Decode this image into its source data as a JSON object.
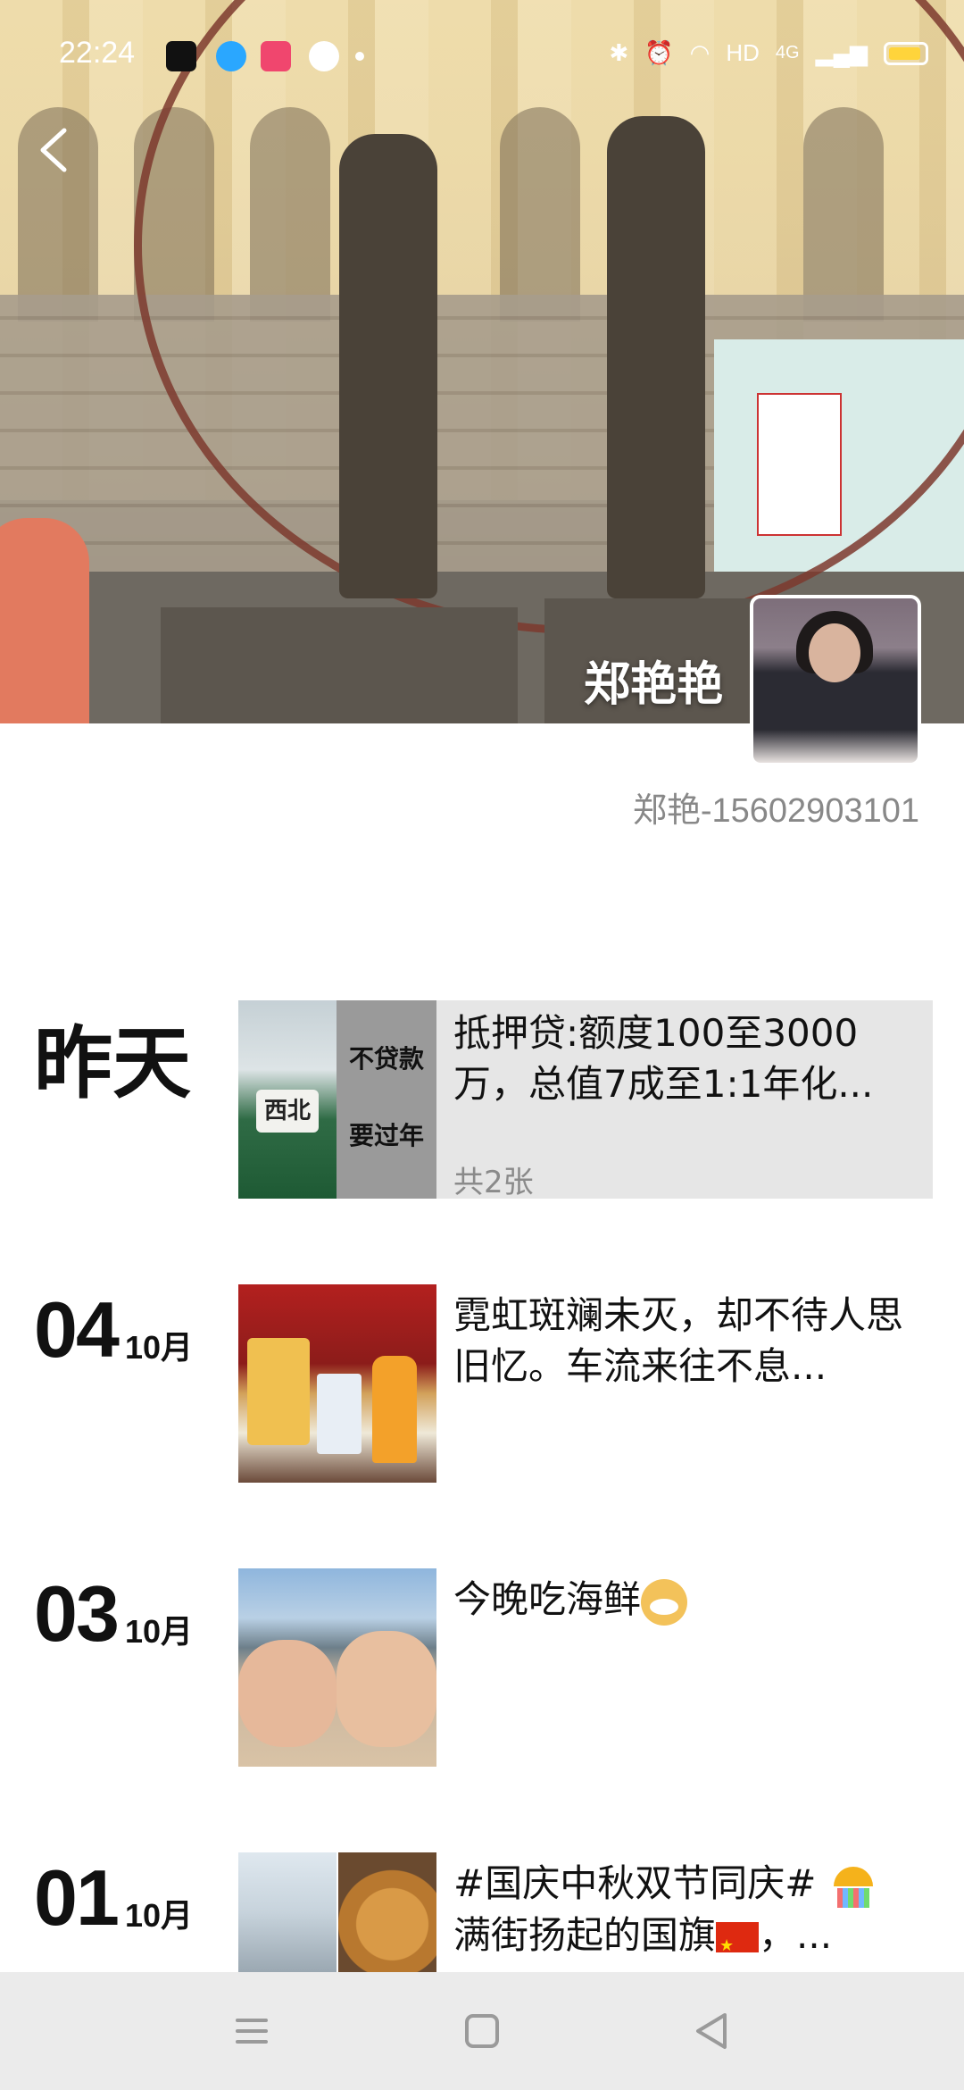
{
  "status_bar": {
    "time": "22:24",
    "network": "HD",
    "cellular": "4G"
  },
  "profile": {
    "display_name": "郑艳艳",
    "signature": "郑艳-15602903101"
  },
  "feed": [
    {
      "date_word": "昨天",
      "text": "抵押贷:额度100至3000万，总值7成至1:1年化...",
      "photo_count": "共2张",
      "thumb_text": [
        "不贷款",
        "要过年",
        "西北"
      ]
    },
    {
      "day": "04",
      "month": "10月",
      "text": "霓虹斑斓未灭，却不待人思旧忆。车流来往不息..."
    },
    {
      "day": "03",
      "month": "10月",
      "text": "今晚吃海鲜"
    },
    {
      "day": "01",
      "month": "10月",
      "text_line1": "#国庆中秋双节同庆#",
      "text_line2": "满街扬起的国旗",
      "text_line2_tail": "，..."
    }
  ],
  "icons": {
    "back": "chevron-left-icon",
    "menu": "menu-icon",
    "home": "square-home-icon",
    "nav_back": "triangle-back-icon"
  }
}
